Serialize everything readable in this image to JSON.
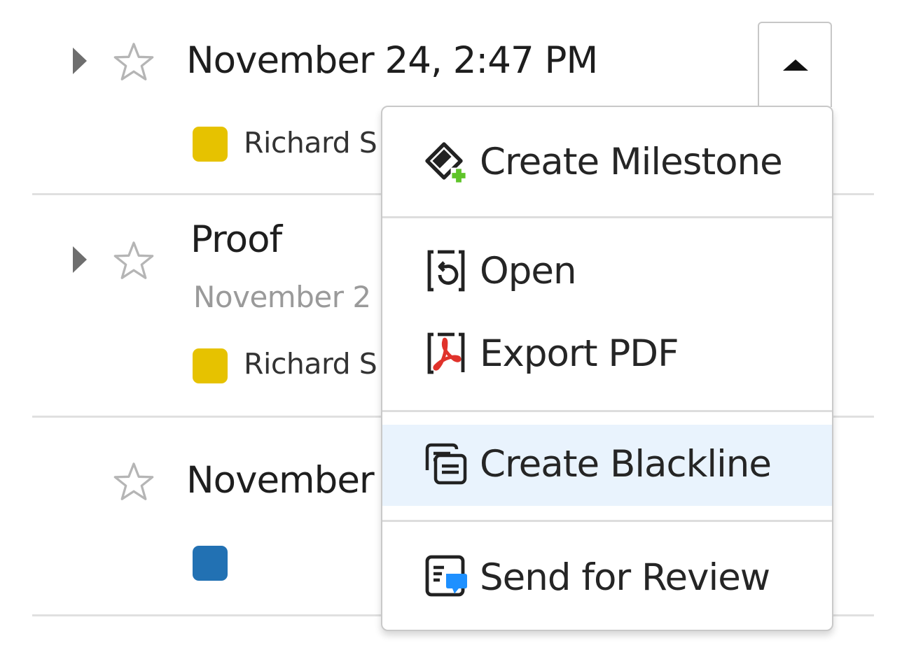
{
  "rows": [
    {
      "title": "November 24, 2:47 PM",
      "author": "Richard S",
      "chip_color": "#e6c200"
    },
    {
      "title": "Proof",
      "subtitle": "November 2",
      "author": "Richard S",
      "chip_color": "#e6c200"
    },
    {
      "title": "November",
      "author": "",
      "chip_color": "#2271b3"
    }
  ],
  "menu": {
    "items": [
      {
        "label": "Create Milestone",
        "icon": "milestone-add-icon"
      },
      {
        "label": "Open",
        "icon": "open-icon"
      },
      {
        "label": "Export PDF",
        "icon": "pdf-icon"
      },
      {
        "label": "Create Blackline",
        "icon": "blackline-icon",
        "highlighted": true
      },
      {
        "label": "Send for Review",
        "icon": "send-review-icon"
      }
    ]
  },
  "colors": {
    "highlight": "#e9f3fd",
    "chip_yellow": "#e6c200",
    "chip_blue": "#2271b3",
    "pdf_red": "#e0322b",
    "add_green": "#5fc42a",
    "review_blue": "#1e90ff"
  }
}
